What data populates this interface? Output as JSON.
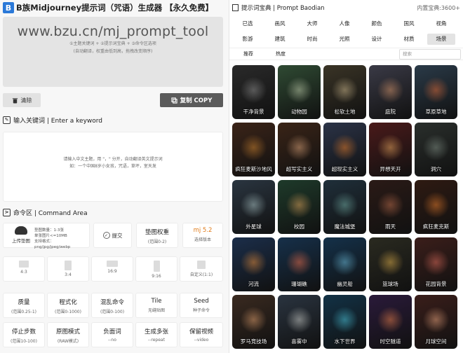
{
  "app": {
    "title": "B族Midjourney提示词（咒语）生成器 【永久免费】"
  },
  "prompt_area": {
    "url": "www.bzu.cn/mj_prompt_tool",
    "hint_line1": "①主题关键词 + ②提示词宝典 + ③命令区选项",
    "hint_line2": "(自动翻译，权重由低到高，拖拽改变顺序)"
  },
  "actions": {
    "clear_label": "清除",
    "copy_label": "复制  COPY"
  },
  "keyword_section": {
    "title": "输入关键词 | Enter a keyword",
    "placeholder_line1": "请输入中文主题，用 \"，\" 分开，自动翻译英文提示词",
    "placeholder_line2": "如：一个中国8岁小女孩，咒语，草坪，室天发"
  },
  "command_section": {
    "title": "命令区 | Command Area",
    "upload": {
      "label": "上传垫图",
      "info1": "垫图数量：1-3张",
      "info2": "单张图片<=10MB",
      "info3": "支持格式：png/jpg/jpeg/webp"
    },
    "submit_label": "提交",
    "image_weight": {
      "title": "垫图权重",
      "sub": "(范围0-2)"
    },
    "version": {
      "title": "mj 5.2",
      "sub": "选择版本"
    },
    "ratios": [
      {
        "label": "4:3"
      },
      {
        "label": "3:4"
      },
      {
        "label": "16:9"
      },
      {
        "label": "9:16"
      },
      {
        "label": "自定义(1:1)"
      }
    ],
    "options_row1": [
      {
        "title": "质量",
        "sub": "(范围0.25-1)"
      },
      {
        "title": "程式化",
        "sub": "(范围0-1000)"
      },
      {
        "title": "混乱命令",
        "sub": "(范围0-100)"
      },
      {
        "title": "Tile",
        "sub": "无缝贴图"
      },
      {
        "title": "Seed",
        "sub": "种子命令"
      }
    ],
    "options_row2": [
      {
        "title": "停止步数",
        "sub": "(范围10-100)"
      },
      {
        "title": "原图模式",
        "sub": "(RAW模式)"
      },
      {
        "title": "负面词",
        "sub": "--no"
      },
      {
        "title": "生成多张",
        "sub": "--repeat"
      },
      {
        "title": "保留视频",
        "sub": "--video"
      }
    ]
  },
  "baodian": {
    "title": "提示词宝典 | Prompt Baodian",
    "count": "内置宝典:3600+",
    "tabs_row1": [
      "已选",
      "画风",
      "大师",
      "人像",
      "颜色",
      "国风",
      "视角"
    ],
    "tabs_row2": [
      "影游",
      "建筑",
      "时尚",
      "光照",
      "设计",
      "材质",
      "场景"
    ],
    "active_tab": "场景",
    "sort": [
      "推荐",
      "热度"
    ],
    "search_placeholder": "搜索",
    "tiles": [
      {
        "label": "干净背景",
        "bg": "#2a2a2a",
        "glow": "#8a8a8a"
      },
      {
        "label": "动物园",
        "bg": "#2f4a33",
        "glow": "#b9c7a6"
      },
      {
        "label": "松软土地",
        "bg": "#3a3426",
        "glow": "#c8b48a"
      },
      {
        "label": "庭院",
        "bg": "#3a3a46",
        "glow": "#d0926a"
      },
      {
        "label": "草原草地",
        "bg": "#2a3a48",
        "glow": "#d96a3a"
      },
      {
        "label": "疯狂麦斯沙地风",
        "bg": "#3b2418",
        "glow": "#c7802f"
      },
      {
        "label": "超写实主义",
        "bg": "#3a2417",
        "glow": "#d6a077"
      },
      {
        "label": "超现实主义",
        "bg": "#2b3347",
        "glow": "#e07a2a"
      },
      {
        "label": "异想天开",
        "bg": "#4a1a1a",
        "glow": "#e1a25c"
      },
      {
        "label": "洞穴",
        "bg": "#2a2f2c",
        "glow": "#7c8a80"
      },
      {
        "label": "外星球",
        "bg": "#2a3540",
        "glow": "#a7c0c2"
      },
      {
        "label": "校园",
        "bg": "#1e3a2a",
        "glow": "#d9a15a"
      },
      {
        "label": "魔法城堡",
        "bg": "#1f2f3a",
        "glow": "#6fa8a0"
      },
      {
        "label": "雨天",
        "bg": "#2a1a16",
        "glow": "#b66a4a"
      },
      {
        "label": "疯狂麦克斯",
        "bg": "#2e1a12",
        "glow": "#e27a2c"
      },
      {
        "label": "河流",
        "bg": "#1b2e4a",
        "glow": "#e08a3c"
      },
      {
        "label": "珊瑚礁",
        "bg": "#16304a",
        "glow": "#e46c4c"
      },
      {
        "label": "幽灵船",
        "bg": "#14314a",
        "glow": "#6ab8d6"
      },
      {
        "label": "篮球场",
        "bg": "#2a2a20",
        "glow": "#d8aa4a"
      },
      {
        "label": "花园背景",
        "bg": "#3b1e1a",
        "glow": "#d96a5a"
      },
      {
        "label": "罗马竞技场",
        "bg": "#3a2a20",
        "glow": "#d89a6a"
      },
      {
        "label": "喜雾中",
        "bg": "#2a3440",
        "glow": "#c6c8c4"
      },
      {
        "label": "水下世界",
        "bg": "#123246",
        "glow": "#4ac0d6"
      },
      {
        "label": "时空隧道",
        "bg": "#2a1a3a",
        "glow": "#e07a4a"
      },
      {
        "label": "月球空间",
        "bg": "#3a1e1a",
        "glow": "#e4a07a"
      }
    ]
  }
}
